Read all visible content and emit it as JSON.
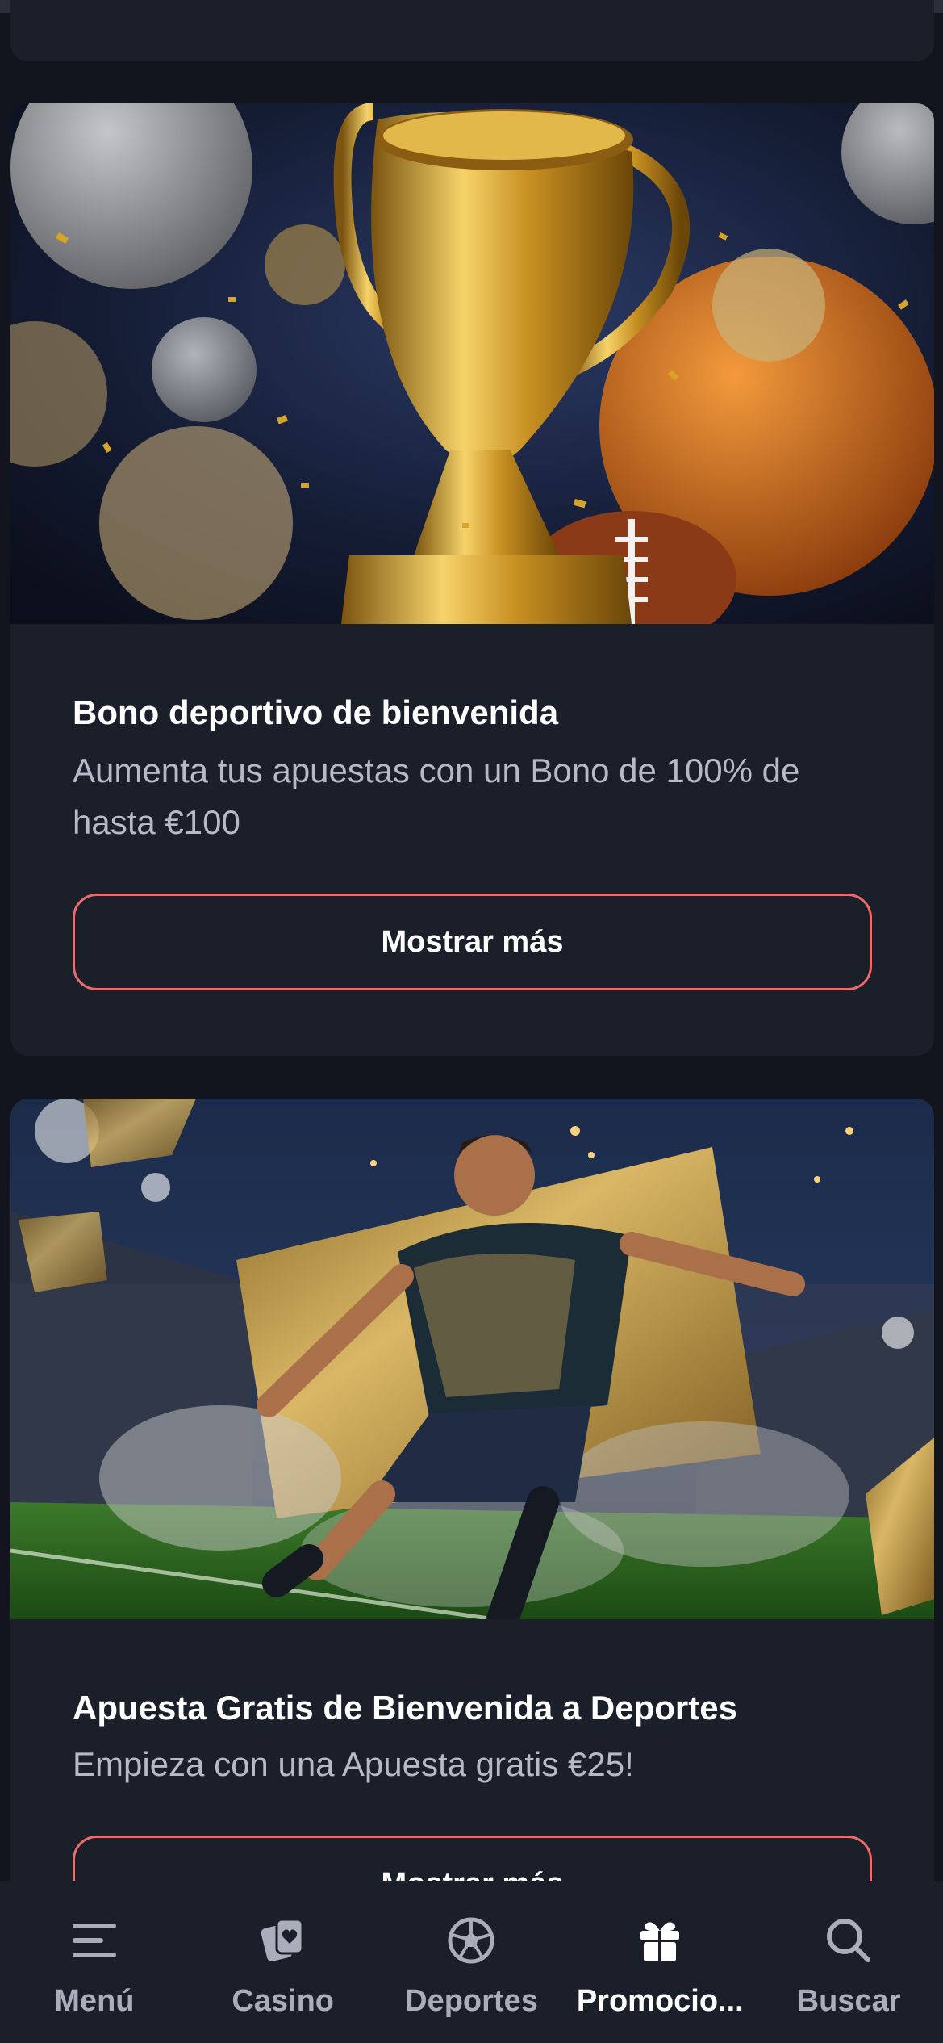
{
  "promos": [
    {
      "title": "Bono deportivo de bienvenida",
      "description": "Aumenta tus apuestas con un Bono de 100% de hasta €100",
      "button_label": "Mostrar más"
    },
    {
      "title": "Apuesta Gratis de Bienvenida a Deportes",
      "description": "Empieza con una Apuesta gratis €25!",
      "button_label": "Mostrar más"
    }
  ],
  "nav": {
    "items": [
      {
        "label": "Menú",
        "icon": "menu-icon"
      },
      {
        "label": "Casino",
        "icon": "casino-cards-icon"
      },
      {
        "label": "Deportes",
        "icon": "soccer-ball-icon"
      },
      {
        "label": "Promocio...",
        "icon": "gift-icon",
        "active": true
      },
      {
        "label": "Buscar",
        "icon": "search-icon"
      }
    ]
  },
  "colors": {
    "background": "#12151d",
    "card": "#1b1f2a",
    "accent_border": "#f06a6a",
    "muted_text": "#b5bac6",
    "nav_inactive": "#a9aebb"
  }
}
